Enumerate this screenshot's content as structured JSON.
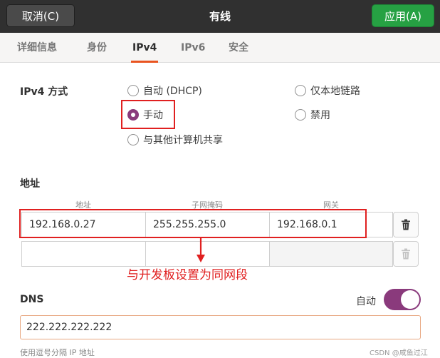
{
  "titlebar": {
    "cancel_label": "取消(C)",
    "title": "有线",
    "apply_label": "应用(A)"
  },
  "tabs": [
    "详细信息",
    "身份",
    "IPv4",
    "IPv6",
    "安全"
  ],
  "active_tab": "IPv4",
  "ipv4_method": {
    "label": "IPv4 方式",
    "options": [
      "自动 (DHCP)",
      "仅本地链路",
      "手动",
      "禁用",
      "与其他计算机共享"
    ],
    "selected": "手动"
  },
  "address": {
    "section_label": "地址",
    "columns": [
      "地址",
      "子网掩码",
      "网关"
    ],
    "rows": [
      [
        "192.168.0.27",
        "255.255.255.0",
        "192.168.0.1"
      ],
      [
        "",
        "",
        ""
      ]
    ]
  },
  "annotation": "与开发板设置为同网段",
  "dns": {
    "label": "DNS",
    "auto_label": "自动",
    "auto_enabled": true,
    "value": "222.222.222.222",
    "hint": "使用逗号分隔 IP 地址"
  },
  "watermark": "CSDN @咸鱼过江",
  "colors": {
    "accent": "#8a3a7c",
    "apply": "#26a143",
    "annotation": "#e02020",
    "tab_underline": "#e95420"
  }
}
